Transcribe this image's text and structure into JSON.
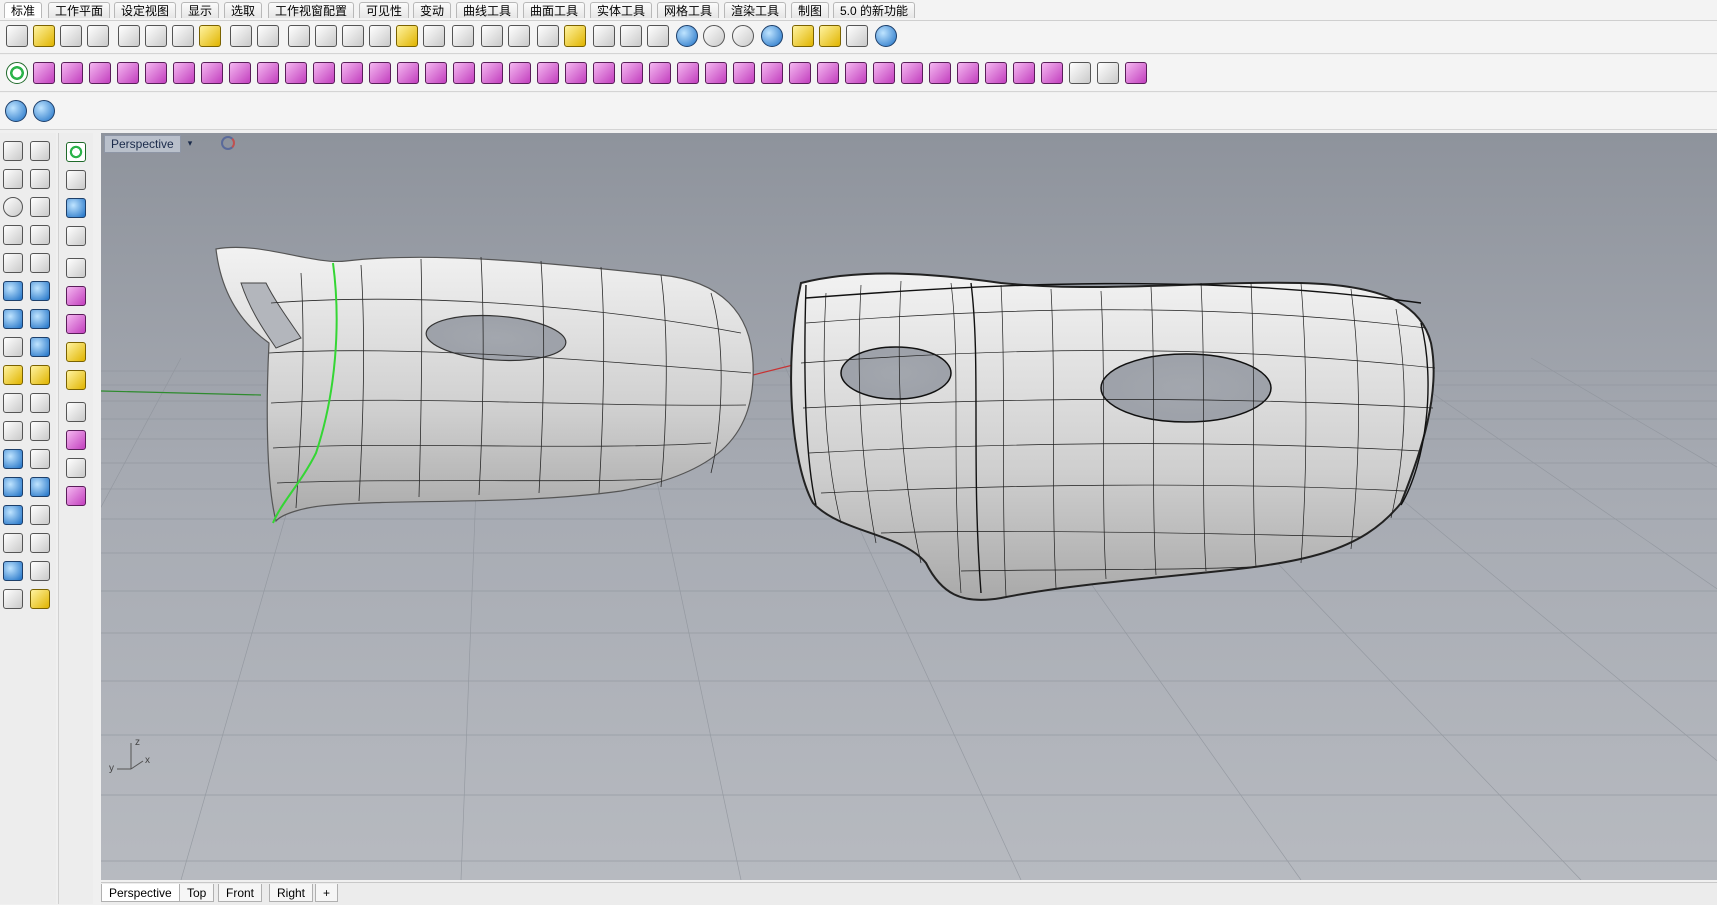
{
  "menu_tabs": [
    {
      "label": "标准",
      "active": true
    },
    {
      "label": "工作平面",
      "active": false
    },
    {
      "label": "设定视图",
      "active": false
    },
    {
      "label": "显示",
      "active": false
    },
    {
      "label": "选取",
      "active": false
    },
    {
      "label": "工作视窗配置",
      "active": false
    },
    {
      "label": "可见性",
      "active": false
    },
    {
      "label": "变动",
      "active": false
    },
    {
      "label": "曲线工具",
      "active": false
    },
    {
      "label": "曲面工具",
      "active": false
    },
    {
      "label": "实体工具",
      "active": false
    },
    {
      "label": "网格工具",
      "active": false
    },
    {
      "label": "渲染工具",
      "active": false
    },
    {
      "label": "制图",
      "active": false
    },
    {
      "label": "5.0 的新功能",
      "active": false
    }
  ],
  "viewport": {
    "title": "Perspective",
    "menu_arrow": "▾",
    "axis_labels": {
      "z": "z",
      "y": "y",
      "x": "x"
    }
  },
  "view_tabs": [
    {
      "label": "Perspective",
      "active": true
    },
    {
      "label": "Top",
      "active": false
    },
    {
      "label": "Front",
      "active": false
    },
    {
      "label": "Right",
      "active": false
    },
    {
      "label": "+",
      "active": false
    }
  ],
  "colors": {
    "viewport_bg": "#a8acb4",
    "grid": "#9a9ea6",
    "x_axis": "#c83232",
    "y_axis": "#2e8b2e",
    "seam_highlight": "#34d634",
    "surface": "#d7d7d7"
  }
}
